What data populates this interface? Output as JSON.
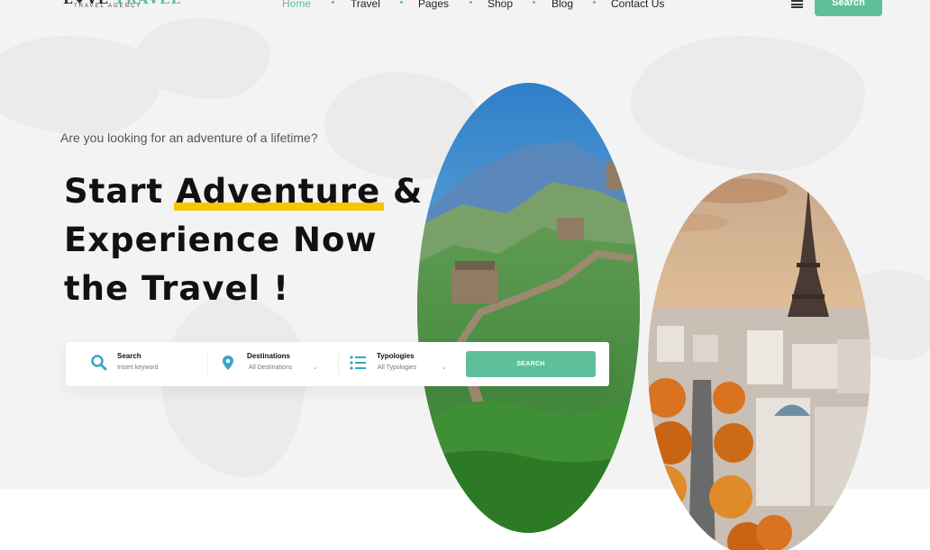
{
  "logo": {
    "brand_part1": "L♥VE ",
    "brand_part2": "TRAVEL",
    "subtitle": "TRAVEL AGENCY"
  },
  "nav": {
    "items": [
      "Home",
      "Travel",
      "Pages",
      "Shop",
      "Blog",
      "Contact Us"
    ],
    "active": "Home"
  },
  "header": {
    "search_label": "Search"
  },
  "hero": {
    "tagline": "Are you looking for an adventure of a lifetime?",
    "headline_start": "Start ",
    "headline_highlight": "Adventure",
    "headline_amp": " &",
    "headline_line2": "Experience Now",
    "headline_line3": "the Travel !"
  },
  "search_bar": {
    "keyword": {
      "label": "Search",
      "placeholder": "Insert keyword"
    },
    "destinations": {
      "label": "Destinations",
      "value": "All Destinations"
    },
    "typologies": {
      "label": "Typologies",
      "value": "All Typologies"
    },
    "button_label": "SEARCH"
  },
  "colors": {
    "accent": "#5fbf9b",
    "highlight": "#f7c600",
    "icon_blue": "#3aa5c8"
  },
  "icons": {
    "keyword": "search-icon",
    "destinations": "map-pin-icon",
    "typologies": "list-icon",
    "menu": "hamburger-icon"
  }
}
